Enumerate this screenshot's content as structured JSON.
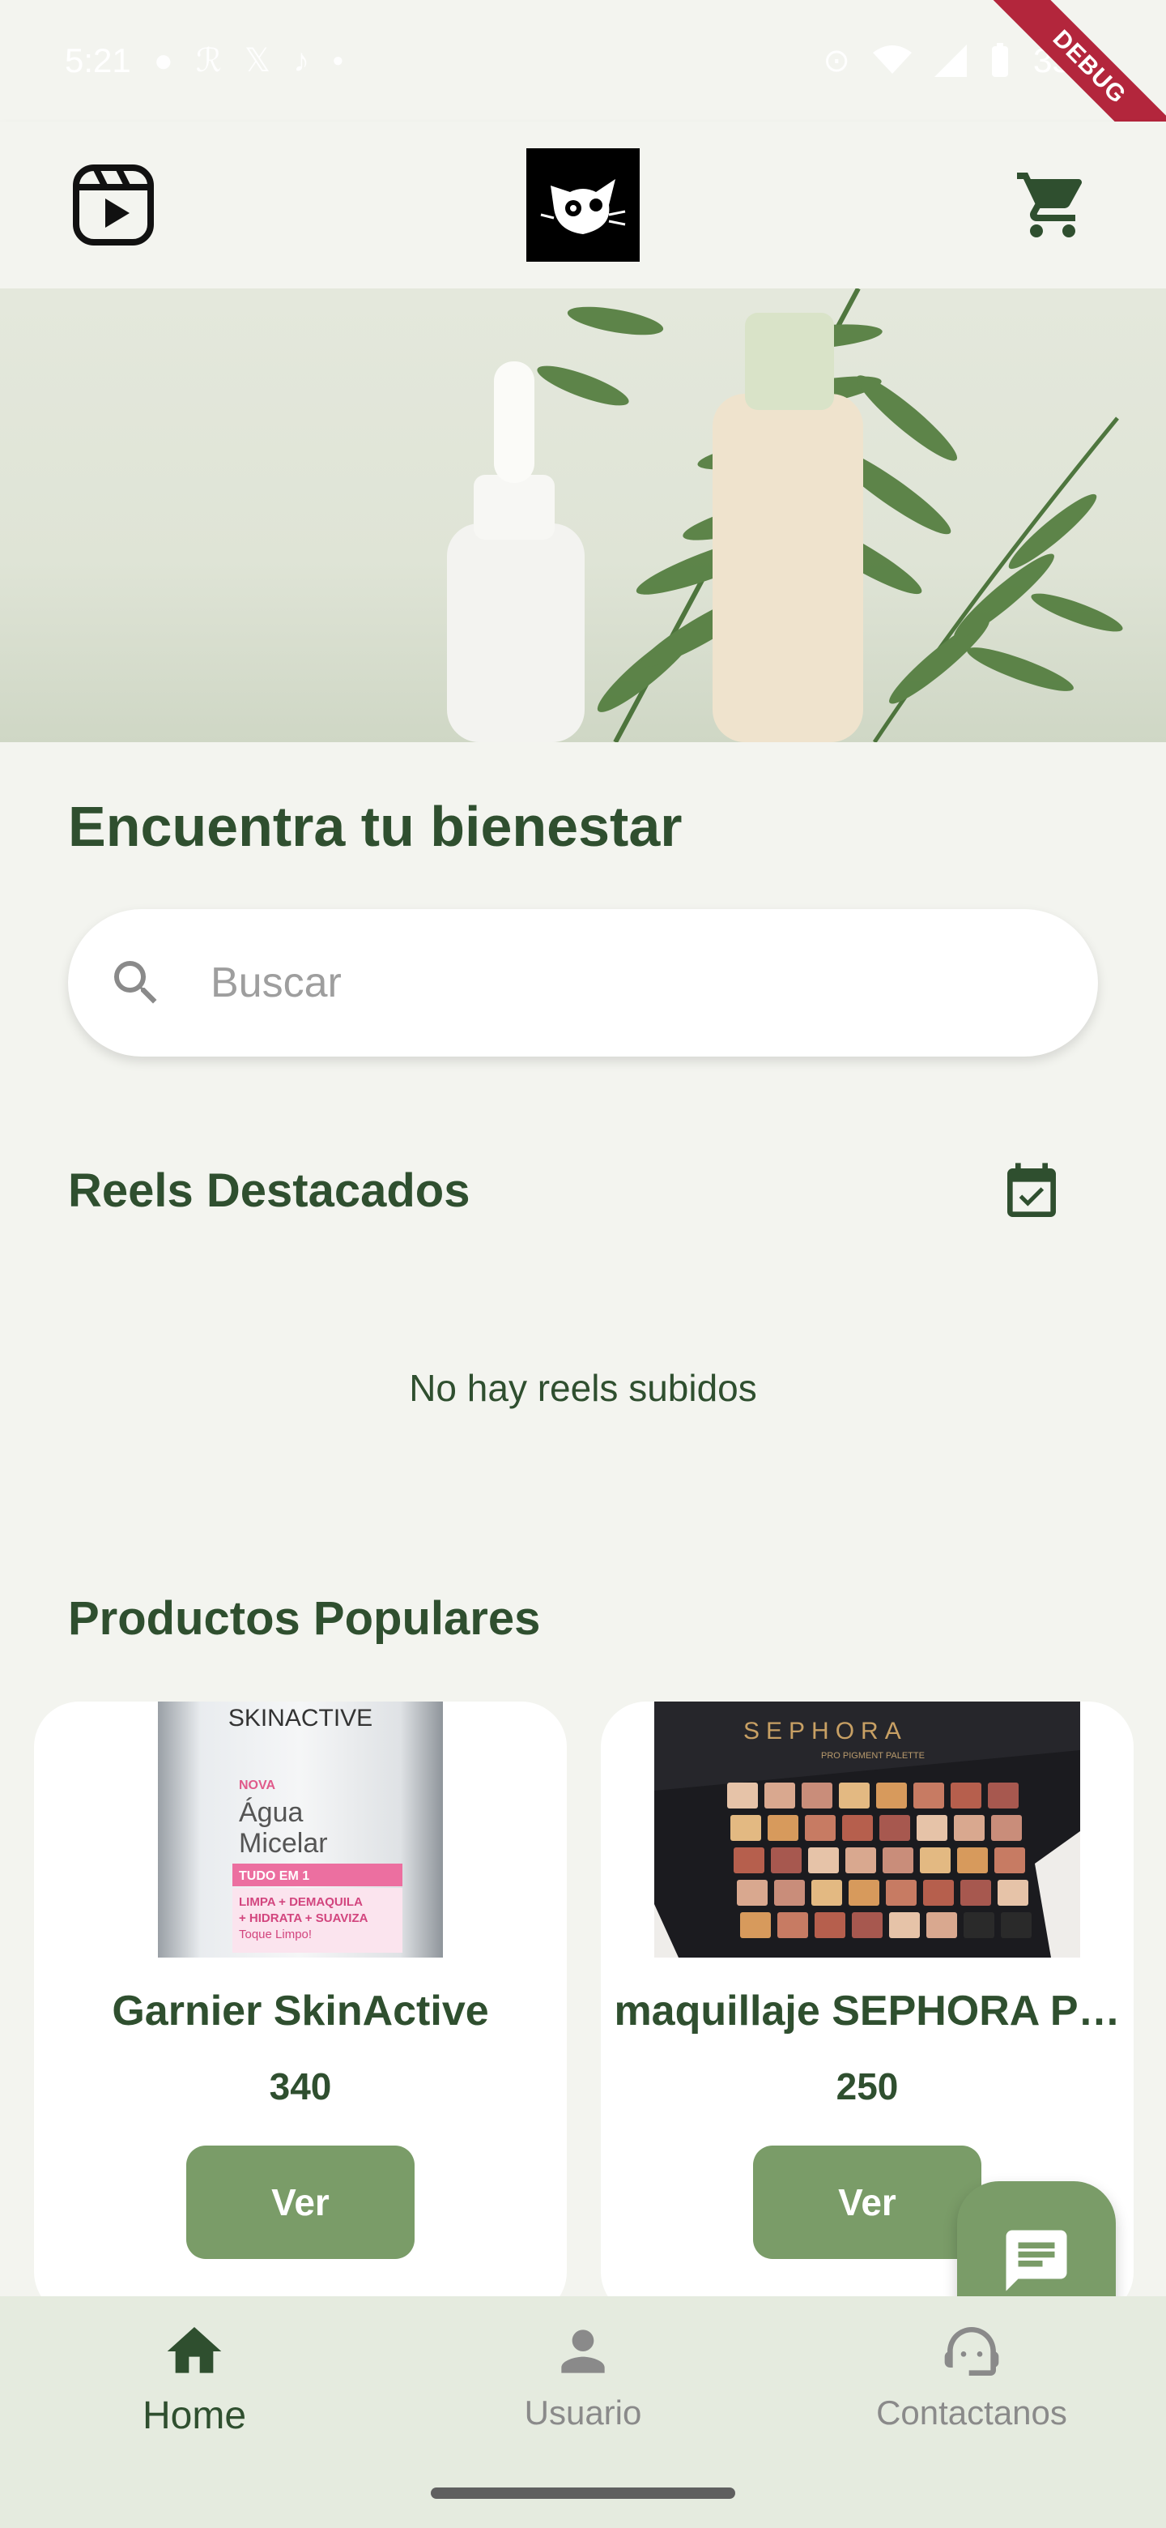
{
  "status_bar": {
    "time": "5:21",
    "battery": "35%"
  },
  "debug_label": "DEBUG",
  "header": {
    "reels_icon": "reels-play-icon",
    "logo_icon": "cat-logo-icon",
    "cart_icon": "shopping-cart-icon"
  },
  "main": {
    "headline": "Encuentra tu bienestar",
    "search": {
      "placeholder": "Buscar",
      "value": ""
    },
    "reels_section": {
      "title": "Reels Destacados",
      "empty_message": "No hay reels subidos"
    },
    "products_section": {
      "title": "Productos Populares",
      "products": [
        {
          "name": "Garnier SkinActive",
          "price": "340",
          "button_label": "Ver",
          "image_text": [
            "SKINACTIVE",
            "NOVA",
            "Água",
            "Micelar",
            "TUDO EM 1",
            "LIMPA + DEMAQUILA",
            "+ HIDRATA + SUAVIZA",
            "Toque Limpo!"
          ]
        },
        {
          "name": "maquillaje SEPHORA P…",
          "price": "250",
          "button_label": "Ver",
          "image_text": [
            "SEPHORA",
            "PRO PIGMENT PALETTE"
          ]
        }
      ]
    }
  },
  "bottom_nav": {
    "items": [
      {
        "label": "Home",
        "icon": "home-icon",
        "active": true
      },
      {
        "label": "Usuario",
        "icon": "user-icon",
        "active": false
      },
      {
        "label": "Contactanos",
        "icon": "support-agent-icon",
        "active": false
      }
    ]
  },
  "colors": {
    "primary_dark": "#2f4f2f",
    "accent_green": "#7a9c68",
    "background": "#f3f4ef",
    "nav_background": "#e5ebdf"
  }
}
